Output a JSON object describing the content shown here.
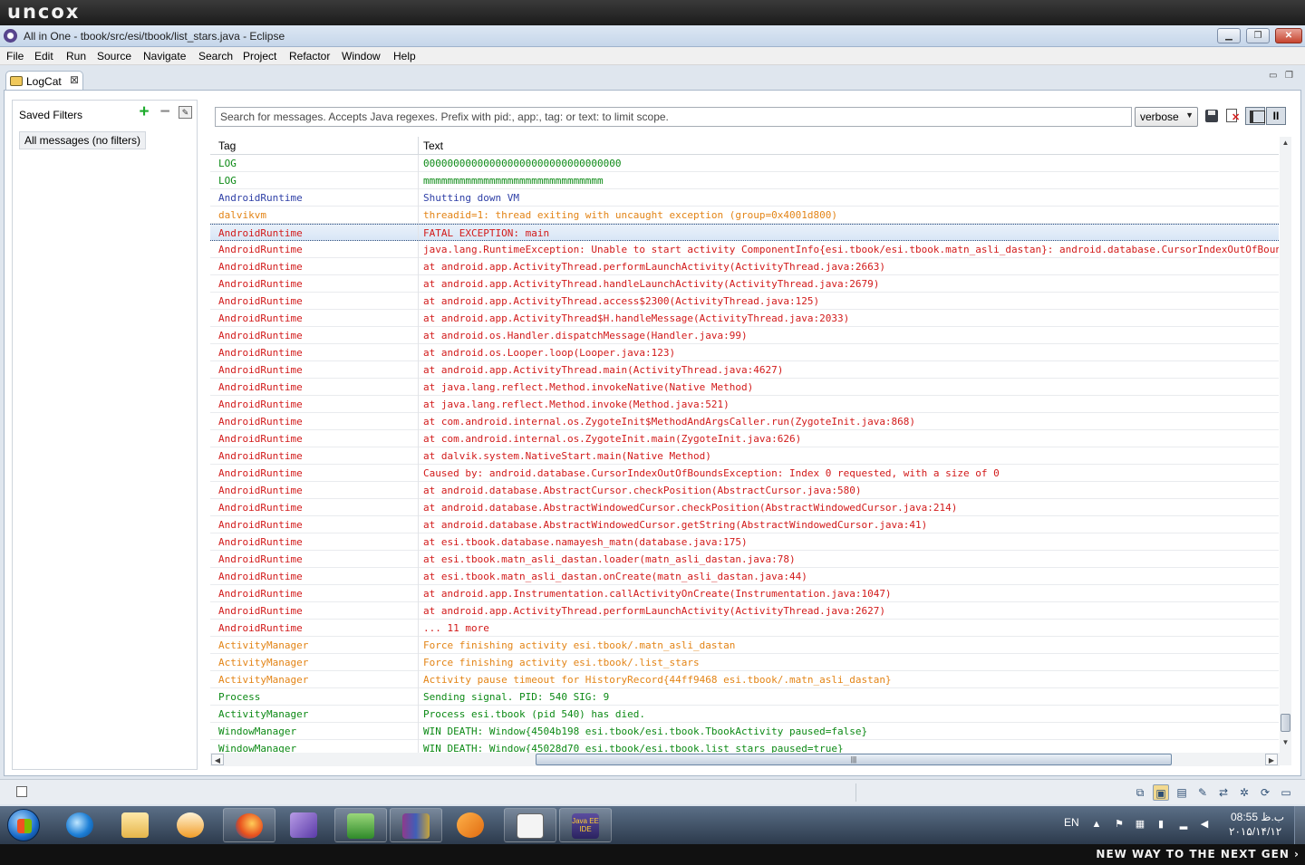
{
  "brand_banner": {
    "logo_text": "uncox"
  },
  "window": {
    "title": "All in One - tbook/src/esi/tbook/list_stars.java - Eclipse",
    "controls": {
      "minimize": "▁",
      "maximize": "❐",
      "close": "✕"
    }
  },
  "menu": [
    "File",
    "Edit",
    "Run",
    "Source",
    "Navigate",
    "Search",
    "Project",
    "Refactor",
    "Window",
    "Help"
  ],
  "view": {
    "tab_label": "LogCat",
    "tab_close": "⊠",
    "minimize": "▭",
    "maximize": "❐"
  },
  "filters": {
    "title": "Saved Filters",
    "add": "+",
    "remove": "−",
    "edit": "✎",
    "items": [
      "All messages (no filters)"
    ]
  },
  "search": {
    "placeholder": "Search for messages. Accepts Java regexes. Prefix with pid:, app:, tag: or text: to limit scope.",
    "value": ""
  },
  "log_level": {
    "selected": "verbose",
    "chevron": "▼"
  },
  "toolbar": {
    "clear_x": "✕",
    "pause": "II"
  },
  "colors": {
    "debug": "#2e3fa6",
    "info": "#0d8a16",
    "warn": "#e38416",
    "error": "#d21a1a",
    "selection": "#d9e6f6"
  },
  "log": {
    "columns": [
      "Tag",
      "Text"
    ],
    "selected_index": 4,
    "rows": [
      {
        "level": "I",
        "tag": "LOG",
        "text": "000000000000000000000000000000000"
      },
      {
        "level": "I",
        "tag": "LOG",
        "text": "mmmmmmmmmmmmmmmmmmmmmmmmmmmmmm"
      },
      {
        "level": "D",
        "tag": "AndroidRuntime",
        "text": "Shutting down VM"
      },
      {
        "level": "W",
        "tag": "dalvikvm",
        "text": "threadid=1: thread exiting with uncaught exception (group=0x4001d800)"
      },
      {
        "level": "E",
        "tag": "AndroidRuntime",
        "text": "FATAL EXCEPTION: main"
      },
      {
        "level": "E",
        "tag": "AndroidRuntime",
        "text": "java.lang.RuntimeException: Unable to start activity ComponentInfo{esi.tbook/esi.tbook.matn_asli_dastan}: android.database.CursorIndexOutOfBoundsException"
      },
      {
        "level": "E",
        "tag": "AndroidRuntime",
        "text": "at android.app.ActivityThread.performLaunchActivity(ActivityThread.java:2663)"
      },
      {
        "level": "E",
        "tag": "AndroidRuntime",
        "text": "at android.app.ActivityThread.handleLaunchActivity(ActivityThread.java:2679)"
      },
      {
        "level": "E",
        "tag": "AndroidRuntime",
        "text": "at android.app.ActivityThread.access$2300(ActivityThread.java:125)"
      },
      {
        "level": "E",
        "tag": "AndroidRuntime",
        "text": "at android.app.ActivityThread$H.handleMessage(ActivityThread.java:2033)"
      },
      {
        "level": "E",
        "tag": "AndroidRuntime",
        "text": "at android.os.Handler.dispatchMessage(Handler.java:99)"
      },
      {
        "level": "E",
        "tag": "AndroidRuntime",
        "text": "at android.os.Looper.loop(Looper.java:123)"
      },
      {
        "level": "E",
        "tag": "AndroidRuntime",
        "text": "at android.app.ActivityThread.main(ActivityThread.java:4627)"
      },
      {
        "level": "E",
        "tag": "AndroidRuntime",
        "text": "at java.lang.reflect.Method.invokeNative(Native Method)"
      },
      {
        "level": "E",
        "tag": "AndroidRuntime",
        "text": "at java.lang.reflect.Method.invoke(Method.java:521)"
      },
      {
        "level": "E",
        "tag": "AndroidRuntime",
        "text": "at com.android.internal.os.ZygoteInit$MethodAndArgsCaller.run(ZygoteInit.java:868)"
      },
      {
        "level": "E",
        "tag": "AndroidRuntime",
        "text": "at com.android.internal.os.ZygoteInit.main(ZygoteInit.java:626)"
      },
      {
        "level": "E",
        "tag": "AndroidRuntime",
        "text": "at dalvik.system.NativeStart.main(Native Method)"
      },
      {
        "level": "E",
        "tag": "AndroidRuntime",
        "text": "Caused by: android.database.CursorIndexOutOfBoundsException: Index 0 requested, with a size of 0"
      },
      {
        "level": "E",
        "tag": "AndroidRuntime",
        "text": "at android.database.AbstractCursor.checkPosition(AbstractCursor.java:580)"
      },
      {
        "level": "E",
        "tag": "AndroidRuntime",
        "text": "at android.database.AbstractWindowedCursor.checkPosition(AbstractWindowedCursor.java:214)"
      },
      {
        "level": "E",
        "tag": "AndroidRuntime",
        "text": "at android.database.AbstractWindowedCursor.getString(AbstractWindowedCursor.java:41)"
      },
      {
        "level": "E",
        "tag": "AndroidRuntime",
        "text": "at esi.tbook.database.namayesh_matn(database.java:175)"
      },
      {
        "level": "E",
        "tag": "AndroidRuntime",
        "text": "at esi.tbook.matn_asli_dastan.loader(matn_asli_dastan.java:78)"
      },
      {
        "level": "E",
        "tag": "AndroidRuntime",
        "text": "at esi.tbook.matn_asli_dastan.onCreate(matn_asli_dastan.java:44)"
      },
      {
        "level": "E",
        "tag": "AndroidRuntime",
        "text": "at android.app.Instrumentation.callActivityOnCreate(Instrumentation.java:1047)"
      },
      {
        "level": "E",
        "tag": "AndroidRuntime",
        "text": "at android.app.ActivityThread.performLaunchActivity(ActivityThread.java:2627)"
      },
      {
        "level": "E",
        "tag": "AndroidRuntime",
        "text": "... 11 more"
      },
      {
        "level": "W",
        "tag": "ActivityManager",
        "text": "  Force finishing activity esi.tbook/.matn_asli_dastan"
      },
      {
        "level": "W",
        "tag": "ActivityManager",
        "text": "  Force finishing activity esi.tbook/.list_stars"
      },
      {
        "level": "W",
        "tag": "ActivityManager",
        "text": "Activity pause timeout for HistoryRecord{44ff9468 esi.tbook/.matn_asli_dastan}"
      },
      {
        "level": "I",
        "tag": "Process",
        "text": "Sending signal. PID: 540 SIG: 9"
      },
      {
        "level": "I",
        "tag": "ActivityManager",
        "text": "Process esi.tbook (pid 540) has died."
      },
      {
        "level": "I",
        "tag": "WindowManager",
        "text": "WIN DEATH: Window{4504b198 esi.tbook/esi.tbook.TbookActivity paused=false}"
      },
      {
        "level": "I",
        "tag": "WindowManager",
        "text": "WIN DEATH: Window{45028d70 esi.tbook/esi.tbook.list_stars paused=true}"
      }
    ]
  },
  "scrollbars": {
    "up": "▲",
    "down": "▼",
    "left": "◀",
    "right": "▶",
    "grip": "|||"
  },
  "taskbar": {
    "apps": [
      "windows-explorer-start",
      "internet-explorer",
      "file-explorer",
      "media-player",
      "firefox",
      "visual-studio",
      "download-manager",
      "winrar",
      "winamp",
      "notepad",
      "eclipse-java-ee"
    ],
    "eclipse_app_label": "Java EE IDE",
    "language": "EN",
    "time": "ب.ظ 08:55",
    "date": "۲۰۱۵/۱۴/۱۲"
  },
  "footer": {
    "slogan": "NEW WAY TO THE NEXT GEN ›"
  }
}
